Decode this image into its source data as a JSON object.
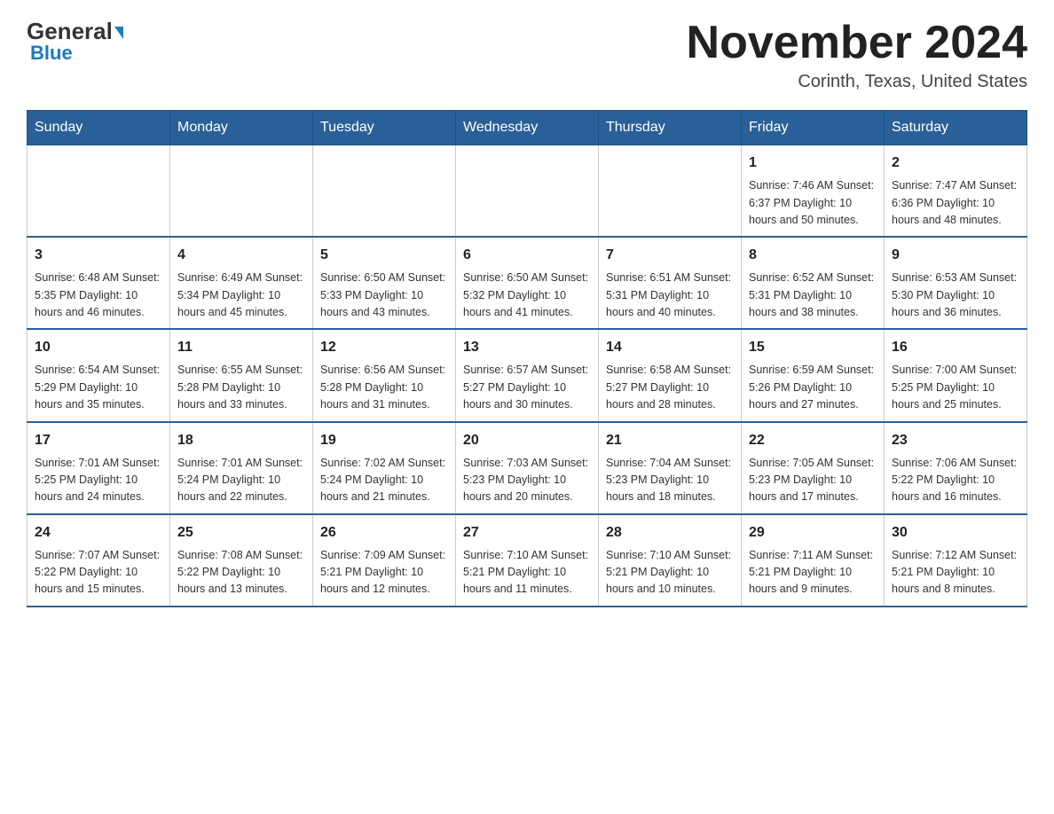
{
  "logo": {
    "general": "General",
    "blue": "Blue",
    "arrow": true
  },
  "title": {
    "month_year": "November 2024",
    "location": "Corinth, Texas, United States"
  },
  "weekdays": [
    "Sunday",
    "Monday",
    "Tuesday",
    "Wednesday",
    "Thursday",
    "Friday",
    "Saturday"
  ],
  "weeks": [
    [
      {
        "day": "",
        "info": ""
      },
      {
        "day": "",
        "info": ""
      },
      {
        "day": "",
        "info": ""
      },
      {
        "day": "",
        "info": ""
      },
      {
        "day": "",
        "info": ""
      },
      {
        "day": "1",
        "info": "Sunrise: 7:46 AM\nSunset: 6:37 PM\nDaylight: 10 hours and 50 minutes."
      },
      {
        "day": "2",
        "info": "Sunrise: 7:47 AM\nSunset: 6:36 PM\nDaylight: 10 hours and 48 minutes."
      }
    ],
    [
      {
        "day": "3",
        "info": "Sunrise: 6:48 AM\nSunset: 5:35 PM\nDaylight: 10 hours and 46 minutes."
      },
      {
        "day": "4",
        "info": "Sunrise: 6:49 AM\nSunset: 5:34 PM\nDaylight: 10 hours and 45 minutes."
      },
      {
        "day": "5",
        "info": "Sunrise: 6:50 AM\nSunset: 5:33 PM\nDaylight: 10 hours and 43 minutes."
      },
      {
        "day": "6",
        "info": "Sunrise: 6:50 AM\nSunset: 5:32 PM\nDaylight: 10 hours and 41 minutes."
      },
      {
        "day": "7",
        "info": "Sunrise: 6:51 AM\nSunset: 5:31 PM\nDaylight: 10 hours and 40 minutes."
      },
      {
        "day": "8",
        "info": "Sunrise: 6:52 AM\nSunset: 5:31 PM\nDaylight: 10 hours and 38 minutes."
      },
      {
        "day": "9",
        "info": "Sunrise: 6:53 AM\nSunset: 5:30 PM\nDaylight: 10 hours and 36 minutes."
      }
    ],
    [
      {
        "day": "10",
        "info": "Sunrise: 6:54 AM\nSunset: 5:29 PM\nDaylight: 10 hours and 35 minutes."
      },
      {
        "day": "11",
        "info": "Sunrise: 6:55 AM\nSunset: 5:28 PM\nDaylight: 10 hours and 33 minutes."
      },
      {
        "day": "12",
        "info": "Sunrise: 6:56 AM\nSunset: 5:28 PM\nDaylight: 10 hours and 31 minutes."
      },
      {
        "day": "13",
        "info": "Sunrise: 6:57 AM\nSunset: 5:27 PM\nDaylight: 10 hours and 30 minutes."
      },
      {
        "day": "14",
        "info": "Sunrise: 6:58 AM\nSunset: 5:27 PM\nDaylight: 10 hours and 28 minutes."
      },
      {
        "day": "15",
        "info": "Sunrise: 6:59 AM\nSunset: 5:26 PM\nDaylight: 10 hours and 27 minutes."
      },
      {
        "day": "16",
        "info": "Sunrise: 7:00 AM\nSunset: 5:25 PM\nDaylight: 10 hours and 25 minutes."
      }
    ],
    [
      {
        "day": "17",
        "info": "Sunrise: 7:01 AM\nSunset: 5:25 PM\nDaylight: 10 hours and 24 minutes."
      },
      {
        "day": "18",
        "info": "Sunrise: 7:01 AM\nSunset: 5:24 PM\nDaylight: 10 hours and 22 minutes."
      },
      {
        "day": "19",
        "info": "Sunrise: 7:02 AM\nSunset: 5:24 PM\nDaylight: 10 hours and 21 minutes."
      },
      {
        "day": "20",
        "info": "Sunrise: 7:03 AM\nSunset: 5:23 PM\nDaylight: 10 hours and 20 minutes."
      },
      {
        "day": "21",
        "info": "Sunrise: 7:04 AM\nSunset: 5:23 PM\nDaylight: 10 hours and 18 minutes."
      },
      {
        "day": "22",
        "info": "Sunrise: 7:05 AM\nSunset: 5:23 PM\nDaylight: 10 hours and 17 minutes."
      },
      {
        "day": "23",
        "info": "Sunrise: 7:06 AM\nSunset: 5:22 PM\nDaylight: 10 hours and 16 minutes."
      }
    ],
    [
      {
        "day": "24",
        "info": "Sunrise: 7:07 AM\nSunset: 5:22 PM\nDaylight: 10 hours and 15 minutes."
      },
      {
        "day": "25",
        "info": "Sunrise: 7:08 AM\nSunset: 5:22 PM\nDaylight: 10 hours and 13 minutes."
      },
      {
        "day": "26",
        "info": "Sunrise: 7:09 AM\nSunset: 5:21 PM\nDaylight: 10 hours and 12 minutes."
      },
      {
        "day": "27",
        "info": "Sunrise: 7:10 AM\nSunset: 5:21 PM\nDaylight: 10 hours and 11 minutes."
      },
      {
        "day": "28",
        "info": "Sunrise: 7:10 AM\nSunset: 5:21 PM\nDaylight: 10 hours and 10 minutes."
      },
      {
        "day": "29",
        "info": "Sunrise: 7:11 AM\nSunset: 5:21 PM\nDaylight: 10 hours and 9 minutes."
      },
      {
        "day": "30",
        "info": "Sunrise: 7:12 AM\nSunset: 5:21 PM\nDaylight: 10 hours and 8 minutes."
      }
    ]
  ]
}
